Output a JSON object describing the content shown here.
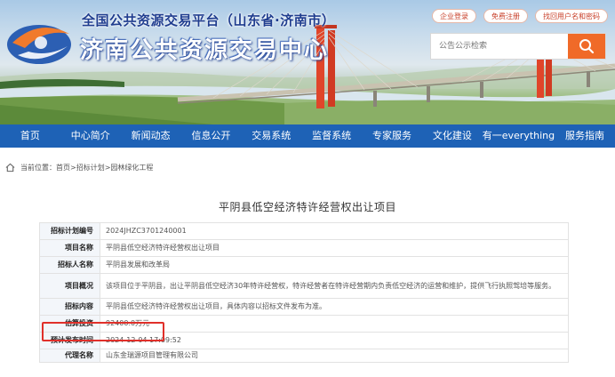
{
  "header": {
    "title_small": "全国公共资源交易平台（山东省·济南市）",
    "title_big": "济南公共资源交易中心",
    "top_links": [
      "企业登录",
      "免费注册",
      "找回用户名和密码"
    ],
    "search_placeholder": "公告公示检索"
  },
  "nav": {
    "items": [
      "首页",
      "中心简介",
      "新闻动态",
      "信息公开",
      "交易系统",
      "监督系统",
      "专家服务",
      "文化建设",
      "有一everything",
      "服务指南"
    ]
  },
  "breadcrumb": {
    "text": "当前位置：首页>招标计划>园林绿化工程"
  },
  "page_title": "平阴县低空经济特许经营权出让项目",
  "details": {
    "rows": [
      {
        "label": "招标计划编号",
        "value": "2024JHZC3701240001"
      },
      {
        "label": "项目名称",
        "value": "平阴县低空经济特许经营权出让项目"
      },
      {
        "label": "招标人名称",
        "value": "平阴县发展和改革局"
      },
      {
        "label": "项目概况",
        "value": "该项目位于平阴县，出让平阴县低空经济30年特许经营权，特许经营者在特许经营期内负责低空经济的运营和维护，提供飞行执照驾培等服务。"
      },
      {
        "label": "招标内容",
        "value": "平阴县低空经济特许经营权出让项目，具体内容以招标文件发布为准。"
      },
      {
        "label": "估算投资",
        "value": "92400.0万元"
      },
      {
        "label": "预计发布时间",
        "value": "2024-12-04 17:09:52"
      },
      {
        "label": "代理名称",
        "value": "山东金瑞源项目管理有限公司"
      }
    ]
  },
  "colors": {
    "nav_bg": "#1e62b6",
    "accent_orange": "#f06a28",
    "highlight_red": "#e0302a",
    "title_blue": "#1f3d8f"
  },
  "icons": {
    "search": "search-icon",
    "home": "home-icon",
    "logo": "logo-icon"
  }
}
